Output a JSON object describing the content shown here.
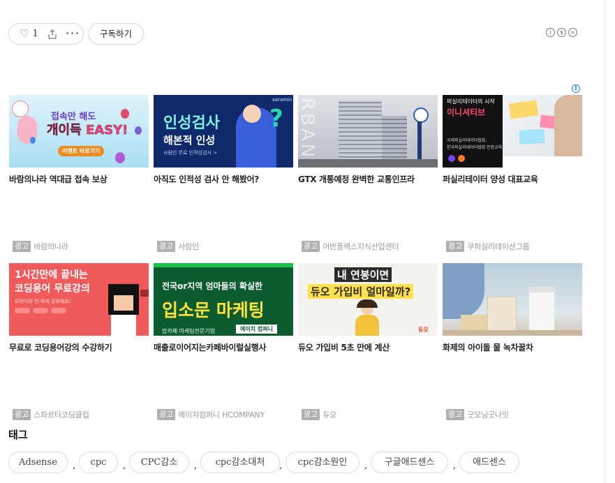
{
  "reactions": {
    "like_count": "1",
    "like_icon": "heart-icon",
    "share_icon": "share-icon",
    "more_icon": "more-icon"
  },
  "subscribe_label": "구독하기",
  "license_icons": [
    "cc-by-icon",
    "cc-nc-icon",
    "cc-nd-icon"
  ],
  "ads": [
    {
      "title": "바람의나라 역대급 접속 보상",
      "badge": "광고",
      "advertiser": "바람의나라",
      "thumb": {
        "small": "접속만 해도",
        "big": "개이득 EASY!",
        "btn": "이벤트 바로가기",
        "bg": "#bfe7f7"
      }
    },
    {
      "title": "아직도 인적성 검사 안 해봤어?",
      "badge": "광고",
      "advertiser": "사람인",
      "thumb": {
        "l1": "인성검사",
        "l2": "해본적 인성",
        "l3": "사람인 무료 인적성검사 >",
        "brand": "saramin",
        "bg": "#0f2a6b"
      }
    },
    {
      "title": "GTX 개통예정 완벽한 교통인프라",
      "badge": "광고",
      "advertiser": "어반플렉스지식산업센터",
      "thumb": {
        "wm": "RBAN",
        "bg": "#c9ccd1"
      }
    },
    {
      "title": "퍼실리테이터 양성 대표교육",
      "badge": "광고",
      "advertiser": "쿠퍼실리테이션그룹",
      "thumb": {
        "l1": "퍼실리테이터의 시작",
        "l2": "이니셔티브",
        "l3": "국제퍼실리테이터협회,",
        "l4": "한국퍼실리테이터협회 인증교육",
        "bg": "#111111"
      }
    },
    {
      "title": "무료로 코딩용어강의 수강하기",
      "badge": "광고",
      "advertiser": "스파르타코딩클럽",
      "thumb": {
        "l1": "1시간만에 끝내는",
        "l2": "코딩용어 무료강의",
        "l3": "르탄이와 찐-하게 공부해요!",
        "bg": "#f15a5a"
      }
    },
    {
      "title": "매출로이어지는카페바이럴실행사",
      "badge": "광고",
      "advertiser": "에이치컴퍼니 HCOMPANY",
      "thumb": {
        "l1": "전국or지역 엄마들의 확실한",
        "l2": "입소문 마케팅",
        "l3": "맘카페 마케팅전문기업",
        "l4": "에이치 컴퍼니",
        "bg": "#0b5c2f"
      }
    },
    {
      "title": "듀오 가입비 5초 만에 계산",
      "badge": "광고",
      "advertiser": "듀오",
      "thumb": {
        "l1": "내 연봉이면",
        "l2": "듀오 가입비 얼마일까?",
        "brand": "듀오",
        "bg": "#f3f3f0"
      }
    },
    {
      "title": "화제의 아이돌 물 녹차꿀차",
      "badge": "광고",
      "advertiser": "굿모닝굿나잇",
      "thumb": {
        "bg": "#c7d6e0"
      }
    }
  ],
  "tags_title": "태그",
  "tags": [
    "Adsense",
    "cpc",
    "CPC감소",
    "cpc감소대처",
    "cpc감소원인",
    "구글애드센스",
    "애드센스"
  ]
}
